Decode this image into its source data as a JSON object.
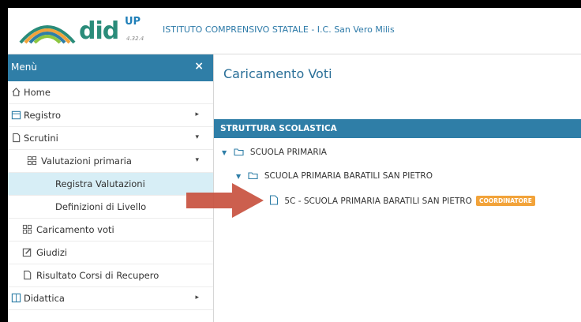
{
  "header": {
    "logo_text": "did",
    "logo_sup": "UP",
    "version": "4.32.4",
    "school_name": "ISTITUTO COMPRENSIVO STATALE - I.C. San Vero Milis"
  },
  "sidebar": {
    "title": "Menù",
    "close_label": "×",
    "items": [
      {
        "label": "Home",
        "icon": "home-icon"
      },
      {
        "label": "Registro",
        "icon": "calendar-icon",
        "arrow": "▸"
      },
      {
        "label": "Scrutini",
        "icon": "document-icon",
        "arrow": "▾"
      },
      {
        "label": "Valutazioni primaria",
        "icon": "grid-icon",
        "arrow": "▾"
      },
      {
        "label": "Registra Valutazioni",
        "active": true
      },
      {
        "label": "Definizioni di Livello"
      },
      {
        "label": "Caricamento voti",
        "icon": "grid-icon"
      },
      {
        "label": "Giudizi",
        "icon": "edit-icon"
      },
      {
        "label": "Risultato Corsi di Recupero",
        "icon": "document-icon"
      },
      {
        "label": "Didattica",
        "icon": "book-icon",
        "arrow": "▸"
      }
    ]
  },
  "main": {
    "title": "Caricamento Voti",
    "table_header": "STRUTTURA SCOLASTICA",
    "tree": [
      {
        "label": "SCUOLA PRIMARIA",
        "level": 0
      },
      {
        "label": "SCUOLA PRIMARIA BARATILI SAN PIETRO",
        "level": 1
      },
      {
        "label": "5C - SCUOLA PRIMARIA BARATILI SAN PIETRO",
        "level": 2,
        "badge": "COORDINATORE"
      }
    ]
  },
  "colors": {
    "accent": "#2f7ea7",
    "badge": "#f2a33a",
    "active_bg": "#d7eef6",
    "arrow": "#c8513f"
  }
}
